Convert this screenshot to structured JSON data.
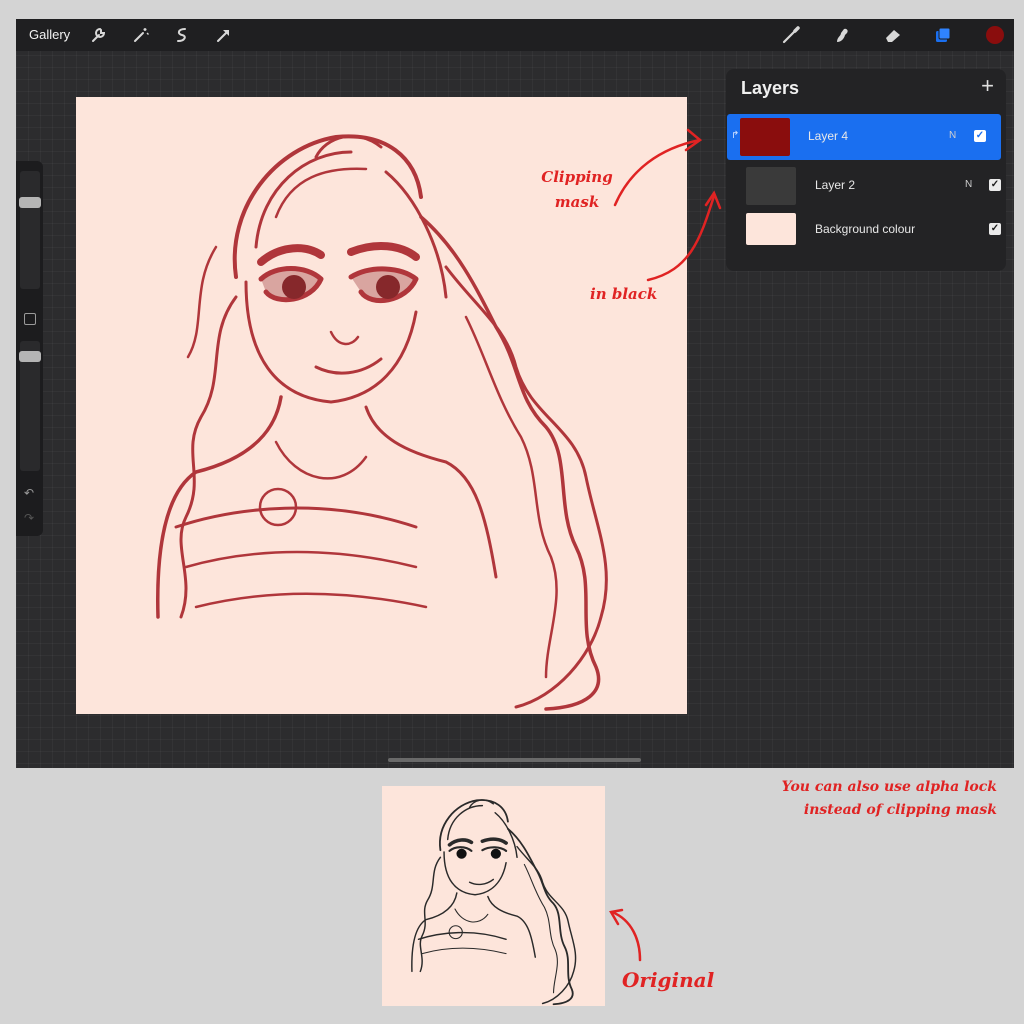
{
  "toolbar": {
    "gallery_label": "Gallery",
    "left_tools": [
      "wrench-icon",
      "magic-wand-icon",
      "selection-icon",
      "transform-arrow-icon"
    ],
    "right_tools": [
      "brush-icon",
      "smudge-icon",
      "eraser-icon",
      "layers-icon",
      "color-swatch"
    ],
    "active_color": "#8a0d0d",
    "accent_color": "#1a6ff0"
  },
  "layers_panel": {
    "title": "Layers",
    "add_symbol": "+",
    "layers": [
      {
        "name": "Layer 4",
        "mode": "N",
        "visible": true,
        "selected": true,
        "clipping": true,
        "thumb_color": "#8a0d0d"
      },
      {
        "name": "Layer 2",
        "mode": "N",
        "visible": true,
        "selected": false,
        "clipping": false,
        "thumb_color": "#3a3a3a"
      },
      {
        "name": "Background colour",
        "mode": "",
        "visible": true,
        "selected": false,
        "clipping": false,
        "thumb_color": "#fde5db"
      }
    ]
  },
  "canvas": {
    "background_color": "#fde5db",
    "stroke_color": "#a8242a"
  },
  "annotations": {
    "clipping_mask": "Clipping mask",
    "in_black": "in black",
    "alpha_lock_line1": "You can also use alpha lock",
    "alpha_lock_line2": "instead of clipping mask",
    "original": "Original",
    "color": "#e02323"
  }
}
